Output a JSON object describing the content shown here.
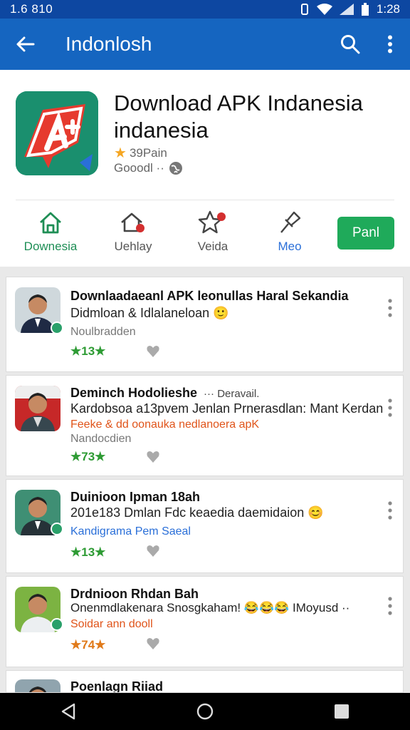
{
  "status_bar": {
    "left_text": "1.6 810",
    "time": "1:28"
  },
  "app_bar": {
    "title": "Indonlosh",
    "back_icon": "arrow-left-icon",
    "search_icon": "search-icon",
    "menu_icon": "more-vert-icon"
  },
  "app": {
    "title_line1": "Download APK Indanesia",
    "title_line2": "indanesia",
    "rating_text": "39Pain",
    "developer_text": "Gooodl  ··",
    "icon_color": "#1a8f6e"
  },
  "actions": [
    {
      "label": "Downesia",
      "icon": "home-icon",
      "color": "#1e8e55"
    },
    {
      "label": "Uehlay",
      "icon": "house-badge-icon",
      "color": "#555555"
    },
    {
      "label": "Veida",
      "icon": "star-badge-icon",
      "color": "#555555"
    },
    {
      "label": "Meo",
      "icon": "pin-icon",
      "color": "#2a6fd8"
    }
  ],
  "install_label": "Panl",
  "accent_color": "#1565c0",
  "install_color": "#1faa5a",
  "posts": [
    {
      "line1": "Downlaadaeanl APK leonullas Haral Sekandia",
      "line2": "Didmloan & Idlalaneloan 🙂",
      "line3": "",
      "meta": "Noulbradden",
      "rating": "★13★"
    },
    {
      "line1": "Deminch Hodolieshe",
      "line1_suffix": "··· Deravail.",
      "line2": "Kardobsoa a13pvem Jenlan Prnerasdlan: Mant Kerdan",
      "line3": "Feeke & dd oonauka nedlanoera apK",
      "meta": "Nandocdien",
      "rating": "★73★"
    },
    {
      "line1": "Duinioon Ipman 18ah",
      "line2": "201e183 Dmlan Fdc keaedia daemidaion 😊",
      "line3": "Kandigrama Pem  Saeal",
      "meta": "",
      "rating": "★13★"
    },
    {
      "line1": "Drdnioon Rhdan Bah",
      "line2": "Onenmdlakenara Snosgkaham! 😂😂😂 IMoyusd ··",
      "line3": "Soidar ann dooll",
      "meta": "",
      "rating": "★74★"
    },
    {
      "line1": "Poenlagn Riiad",
      "line2": "",
      "line3": "",
      "meta": "",
      "rating": ""
    }
  ]
}
